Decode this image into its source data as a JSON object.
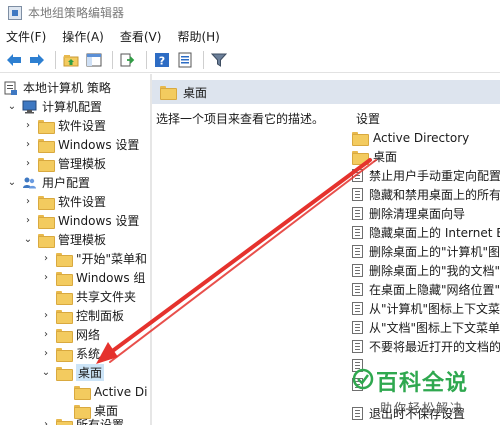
{
  "window": {
    "title": "本地组策略编辑器"
  },
  "menubar": {
    "items": [
      "文件(F)",
      "操作(A)",
      "查看(V)",
      "帮助(H)"
    ]
  },
  "tree": {
    "root": "本地计算机 策略",
    "computer_config": "计算机配置",
    "cc_software": "软件设置",
    "cc_windows": "Windows 设置",
    "cc_admin": "管理模板",
    "user_config": "用户配置",
    "uc_software": "软件设置",
    "uc_windows": "Windows 设置",
    "uc_admin": "管理模板",
    "start_menu": "\"开始\"菜单和",
    "windows_components": "Windows 组",
    "shared_folders": "共享文件夹",
    "control_panel": "控制面板",
    "network": "网络",
    "system": "系统",
    "desktop": "桌面",
    "active_directory": "Active Di",
    "desktop_sub": "桌面",
    "all_settings": "所有设置"
  },
  "right_pane": {
    "header": "桌面",
    "description": "选择一个项目来查看它的描述。",
    "column_header": "设置",
    "folders": [
      "Active Directory",
      "桌面"
    ],
    "settings": [
      "禁止用户手动重定向配置文",
      "隐藏和禁用桌面上的所有项",
      "删除清理桌面向导",
      "隐藏桌面上的 Internet Ex",
      "删除桌面上的\"计算机\"图标",
      "删除桌面上的\"我的文档\"图",
      "在桌面上隐藏\"网络位置\"图",
      "从\"计算机\"图标上下文菜单",
      "从\"文档\"图标上下文菜单中",
      "不要将最近打开的文档的共",
      "",
      "",
      "退出时不保存设置"
    ]
  },
  "watermark": {
    "title": "百科全说",
    "subtitle": "助你轻松解决"
  },
  "colors": {
    "annotation_arrow": "#e5322d",
    "watermark_green": "#2fa84f",
    "folder_yellow": "#f3cb5f",
    "header_bg": "#dde4ee"
  },
  "icons": {
    "toolbar": [
      "back-arrow-icon",
      "forward-arrow-icon",
      "up-folder-icon",
      "show-hide-tree-icon",
      "export-list-icon",
      "help-icon",
      "properties-icon",
      "filter-icon"
    ]
  }
}
